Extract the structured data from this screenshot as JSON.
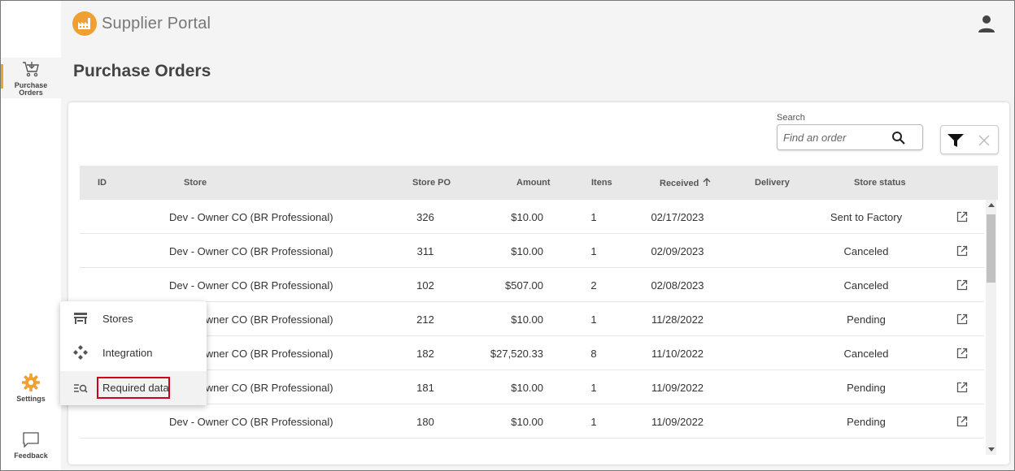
{
  "app": {
    "brand": "Supplier Portal"
  },
  "nav": {
    "purchase_orders_line1": "Purchase",
    "purchase_orders_line2": "Orders",
    "settings": "Settings",
    "feedback": "Feedback"
  },
  "page": {
    "title": "Purchase Orders"
  },
  "search": {
    "label": "Search",
    "placeholder": "Find an order"
  },
  "table": {
    "headers": {
      "id": "ID",
      "store": "Store",
      "store_po": "Store PO",
      "amount": "Amount",
      "items": "Itens",
      "received": "Received",
      "delivery": "Delivery",
      "store_status": "Store status"
    },
    "rows": [
      {
        "id": "",
        "store": "Dev - Owner CO (BR Professional)",
        "store_po": "326",
        "amount": "$10.00",
        "items": "1",
        "received": "02/17/2023",
        "delivery": "",
        "status": "Sent to Factory"
      },
      {
        "id": "",
        "store": "Dev - Owner CO (BR Professional)",
        "store_po": "311",
        "amount": "$10.00",
        "items": "1",
        "received": "02/09/2023",
        "delivery": "",
        "status": "Canceled"
      },
      {
        "id": "",
        "store": "Dev - Owner CO (BR Professional)",
        "store_po": "102",
        "amount": "$507.00",
        "items": "2",
        "received": "02/08/2023",
        "delivery": "",
        "status": "Canceled"
      },
      {
        "id": "",
        "store": "Dev - Owner CO (BR Professional)",
        "store_po": "212",
        "amount": "$10.00",
        "items": "1",
        "received": "11/28/2022",
        "delivery": "",
        "status": "Pending"
      },
      {
        "id": "",
        "store": "Dev - Owner CO (BR Professional)",
        "store_po": "182",
        "amount": "$27,520.33",
        "items": "8",
        "received": "11/10/2022",
        "delivery": "",
        "status": "Canceled"
      },
      {
        "id": "",
        "store": "Dev - Owner CO (BR Professional)",
        "store_po": "181",
        "amount": "$10.00",
        "items": "1",
        "received": "11/09/2022",
        "delivery": "",
        "status": "Pending"
      },
      {
        "id": "",
        "store": "Dev - Owner CO (BR Professional)",
        "store_po": "180",
        "amount": "$10.00",
        "items": "1",
        "received": "11/09/2022",
        "delivery": "",
        "status": "Pending"
      }
    ]
  },
  "settings_menu": {
    "items": [
      {
        "label": "Stores",
        "icon": "store-icon"
      },
      {
        "label": "Integration",
        "icon": "integration-icon"
      },
      {
        "label": "Required data",
        "icon": "required-data-icon",
        "highlighted": true
      }
    ]
  },
  "colors": {
    "accent": "#f0a030",
    "highlight": "#d0021b"
  }
}
